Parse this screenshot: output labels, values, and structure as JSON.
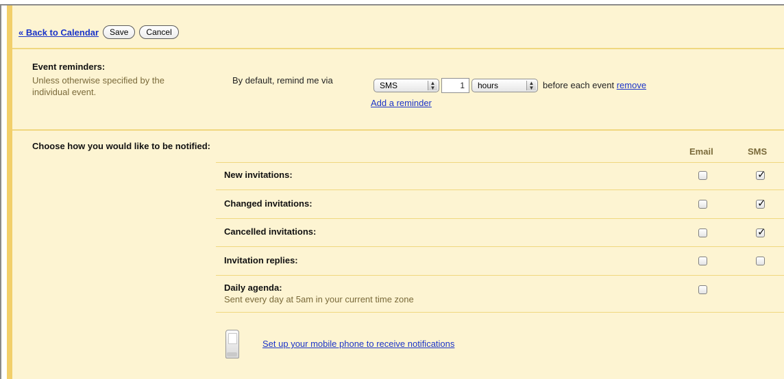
{
  "header": {
    "back_label": "« Back to Calendar",
    "save_label": "Save",
    "cancel_label": "Cancel"
  },
  "reminders": {
    "title": "Event reminders:",
    "subtitle": "Unless otherwise specified by the individual event.",
    "prefix": "By default, remind me via",
    "method": "SMS",
    "amount": "1",
    "unit": "hours",
    "suffix": "before each event",
    "remove_label": "remove",
    "add_label": "Add a reminder"
  },
  "notify": {
    "title": "Choose how you would like to be notified:",
    "col_email": "Email",
    "col_sms": "SMS",
    "rows": [
      {
        "label": "New invitations:",
        "email": false,
        "sms": true
      },
      {
        "label": "Changed invitations:",
        "email": false,
        "sms": true
      },
      {
        "label": "Cancelled invitations:",
        "email": false,
        "sms": true
      },
      {
        "label": "Invitation replies:",
        "email": false,
        "sms": false
      },
      {
        "label": "Daily agenda:",
        "sub": "Sent every day at 5am in your current time zone",
        "email": false
      }
    ],
    "mobile_link": "Set up your mobile phone to receive notifications"
  }
}
